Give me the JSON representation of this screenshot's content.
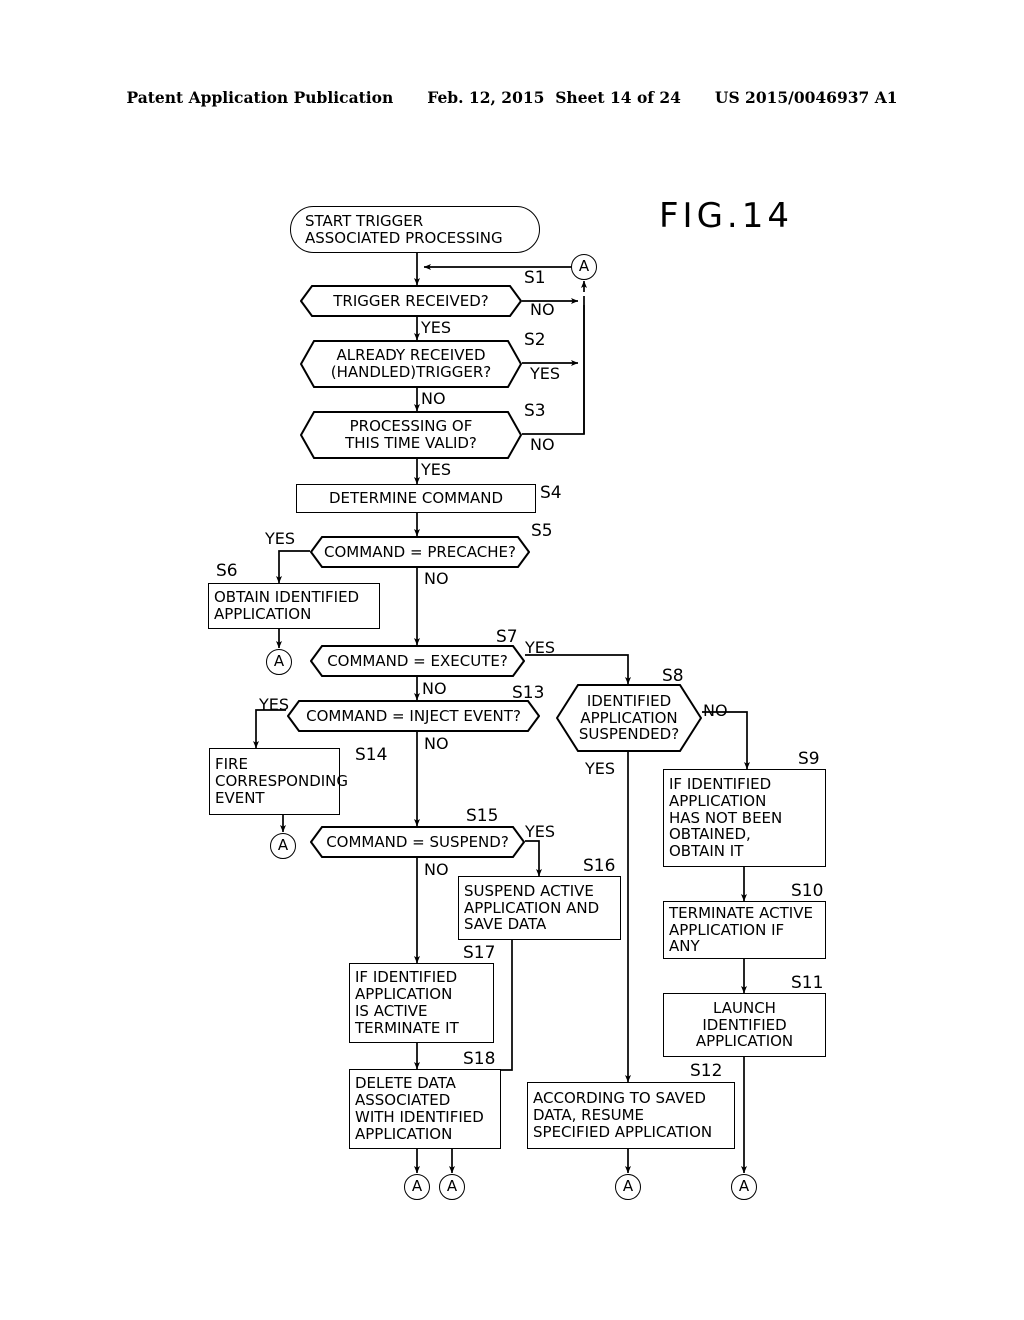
{
  "header": {
    "publication": "Patent Application Publication",
    "date": "Feb. 12, 2015",
    "sheet": "Sheet 14 of 24",
    "docnum": "US 2015/0046937 A1"
  },
  "figure": {
    "label": "FIG.14"
  },
  "nodes": {
    "start": {
      "text": "START TRIGGER\nASSOCIATED PROCESSING"
    },
    "s1": {
      "step": "S1",
      "text": "TRIGGER RECEIVED?"
    },
    "s2": {
      "step": "S2",
      "text": "ALREADY RECEIVED\n(HANDLED)TRIGGER?"
    },
    "s3": {
      "step": "S3",
      "text": "PROCESSING OF\nTHIS TIME VALID?"
    },
    "s4": {
      "step": "S4",
      "text": "DETERMINE COMMAND"
    },
    "s5": {
      "step": "S5",
      "text": "COMMAND = PRECACHE?"
    },
    "s6": {
      "step": "S6",
      "text": "OBTAIN IDENTIFIED\nAPPLICATION"
    },
    "s7": {
      "step": "S7",
      "text": "COMMAND = EXECUTE?"
    },
    "s8": {
      "step": "S8",
      "text": "IDENTIFIED\nAPPLICATION\nSUSPENDED?"
    },
    "s9": {
      "step": "S9",
      "text": "IF IDENTIFIED\nAPPLICATION\nHAS NOT BEEN\nOBTAINED,\nOBTAIN IT"
    },
    "s10": {
      "step": "S10",
      "text": "TERMINATE ACTIVE\nAPPLICATION IF\nANY"
    },
    "s11": {
      "step": "S11",
      "text": "LAUNCH\nIDENTIFIED\nAPPLICATION"
    },
    "s12": {
      "step": "S12",
      "text": "ACCORDING TO SAVED\nDATA, RESUME\nSPECIFIED APPLICATION"
    },
    "s13": {
      "step": "S13",
      "text": "COMMAND = INJECT EVENT?"
    },
    "s14": {
      "step": "S14",
      "text": "FIRE\nCORRESPONDING\nEVENT"
    },
    "s15": {
      "step": "S15",
      "text": "COMMAND = SUSPEND?"
    },
    "s16": {
      "step": "S16",
      "text": "SUSPEND ACTIVE\nAPPLICATION AND\nSAVE DATA"
    },
    "s17": {
      "step": "S17",
      "text": "IF IDENTIFIED\nAPPLICATION\nIS ACTIVE\nTERMINATE IT"
    },
    "s18": {
      "step": "S18",
      "text": "DELETE DATA\nASSOCIATED\nWITH IDENTIFIED\nAPPLICATION"
    }
  },
  "connectors": {
    "a_top": {
      "label": "A"
    },
    "a_s6": {
      "label": "A"
    },
    "a_s14": {
      "label": "A"
    },
    "a_bottom_1": {
      "label": "A"
    },
    "a_bottom_2": {
      "label": "A"
    },
    "a_bottom_3": {
      "label": "A"
    },
    "a_bottom_4": {
      "label": "A"
    }
  },
  "edge_labels": {
    "s1_no": "NO",
    "s1_yes": "YES",
    "s2_yes": "YES",
    "s2_no": "NO",
    "s3_no": "NO",
    "s3_yes": "YES",
    "s5_yes": "YES",
    "s5_no": "NO",
    "s7_yes": "YES",
    "s7_no": "NO",
    "s8_no": "NO",
    "s8_yes": "YES",
    "s13_yes": "YES",
    "s13_no": "NO",
    "s15_yes": "YES",
    "s15_no": "NO"
  },
  "colors": {
    "ink": "#000000",
    "paper": "#ffffff"
  }
}
